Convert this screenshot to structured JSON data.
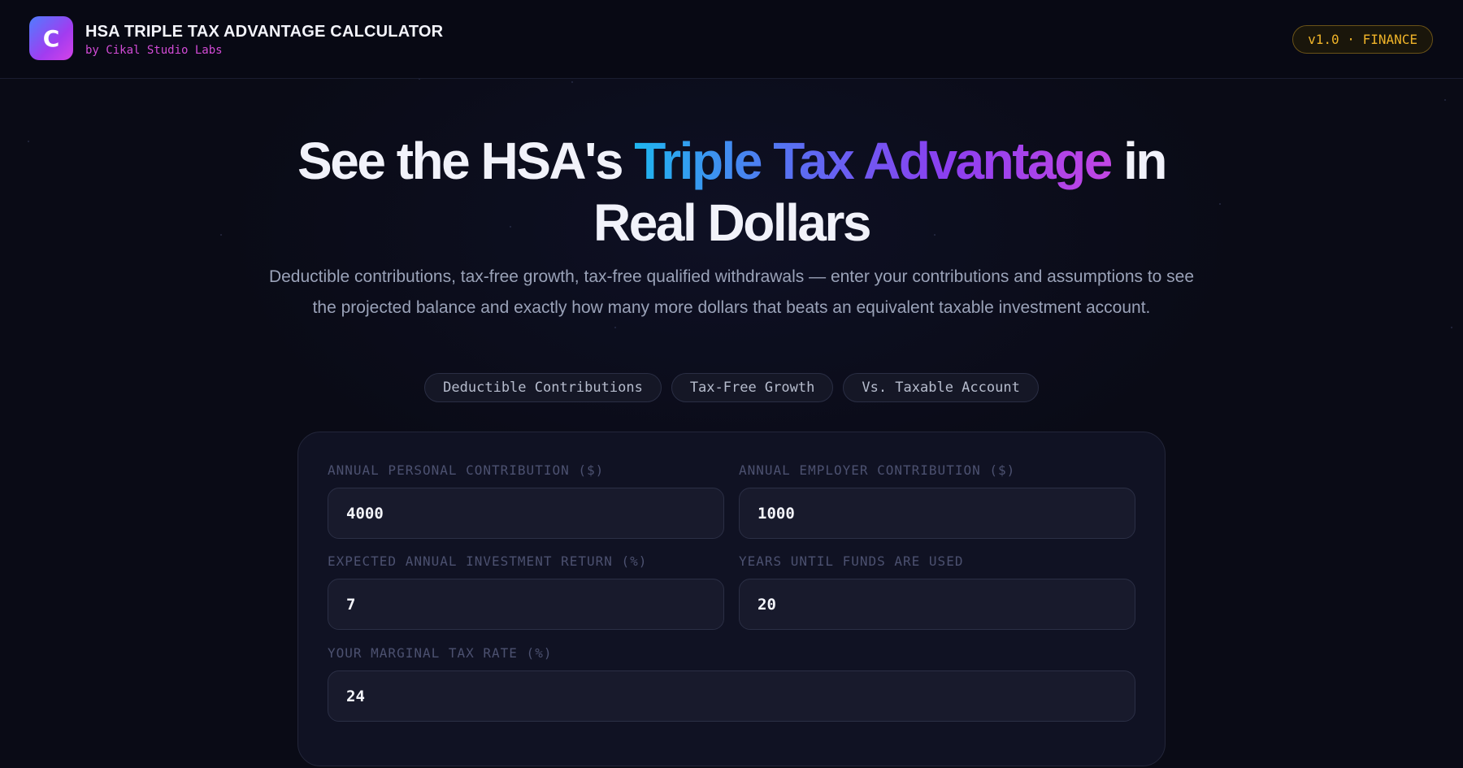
{
  "app": {
    "logo_letter": "C",
    "title": "HSA TRIPLE TAX ADVANTAGE CALCULATOR",
    "subtitle": "by Cikal Studio Labs",
    "version_badge": "v1.0 · FINANCE"
  },
  "hero": {
    "title_before": "See the HSA's ",
    "title_highlight": "Triple Tax Advantage",
    "title_after": " in Real Dollars",
    "description": "Deductible contributions, tax-free growth, tax-free qualified withdrawals — enter your contributions and assumptions to see the projected balance and exactly how many more dollars that beats an equivalent taxable investment account."
  },
  "chips": [
    "Deductible Contributions",
    "Tax-Free Growth",
    "Vs. Taxable Account"
  ],
  "form": {
    "personal": {
      "label": "ANNUAL PERSONAL CONTRIBUTION ($)",
      "value": "4000"
    },
    "employer": {
      "label": "ANNUAL EMPLOYER CONTRIBUTION ($)",
      "value": "1000"
    },
    "return_rate": {
      "label": "EXPECTED ANNUAL INVESTMENT RETURN (%)",
      "value": "7"
    },
    "years": {
      "label": "YEARS UNTIL FUNDS ARE USED",
      "value": "20"
    },
    "tax_rate": {
      "label": "YOUR MARGINAL TAX RATE (%)",
      "value": "24"
    }
  },
  "colors": {
    "background": "#0a0b16",
    "accent_gradient_start": "#1fb6ef",
    "accent_gradient_end": "#c246e4",
    "subtitle_magenta": "#d24bd6",
    "badge_amber": "#f0b429"
  }
}
